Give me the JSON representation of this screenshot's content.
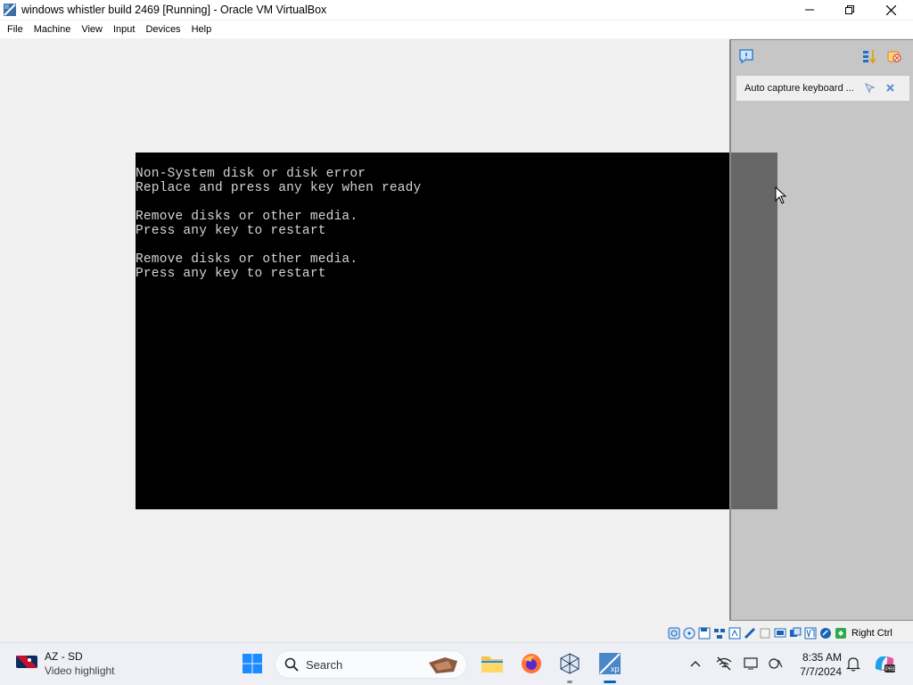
{
  "window": {
    "title": "windows whistler build 2469 [Running] - Oracle VM VirtualBox",
    "controls": [
      "minimize-icon",
      "maximize-icon",
      "close-icon"
    ]
  },
  "menu": {
    "items": [
      "File",
      "Machine",
      "View",
      "Input",
      "Devices",
      "Help"
    ]
  },
  "guest_screen": {
    "text": "Non-System disk or disk error\nReplace and press any key when ready\n\nRemove disks or other media.\nPress any key to restart\n\nRemove disks or other media.\nPress any key to restart"
  },
  "notification_panel": {
    "notification_text": "Auto capture keyboard ...",
    "icons": [
      "notification-center-icon",
      "sort-icon",
      "dismiss-all-icon",
      "pin-icon",
      "close-notification-icon"
    ]
  },
  "statusbar": {
    "host_key": "Right Ctrl",
    "icons": [
      "hard-disk-icon",
      "optical-drive-icon",
      "floppy-icon",
      "network-icon",
      "usb-icon",
      "shared-folders-icon",
      "display-icon",
      "video-capture-icon",
      "cpu-icon",
      "recording-icon",
      "mouse-integration-icon",
      "keyboard-capture-icon"
    ]
  },
  "taskbar": {
    "weather_line1": "AZ - SD",
    "weather_line2": "Video highlight",
    "search_placeholder": "Search",
    "time": "8:35 AM",
    "date": "7/7/2024",
    "apps": [
      "windows-start-icon",
      "search-icon",
      "file-explorer-icon",
      "firefox-icon",
      "virtualbox-icon",
      "windows-xp-vm-icon"
    ],
    "tray": [
      "chevron-up-icon",
      "network-off-icon",
      "battery-icon",
      "display-settings-icon",
      "bell-icon",
      "copilot-icon"
    ]
  },
  "colors": {
    "guest_background": "#000000",
    "guest_text": "#d4d4d4",
    "host_background": "#f0f0f0",
    "taskbar": "#eef0f5",
    "accent": "#0067c0"
  }
}
